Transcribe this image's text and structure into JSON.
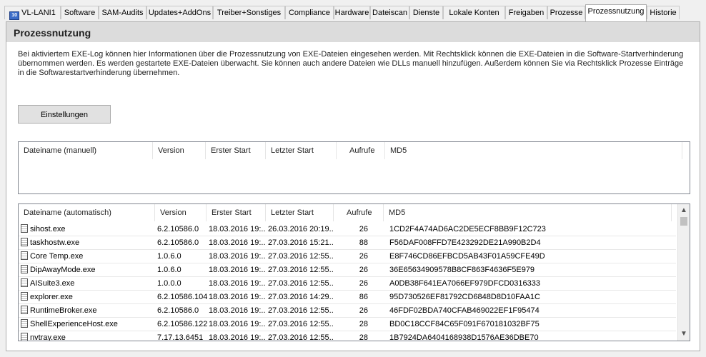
{
  "tabs": [
    {
      "label": "VL-LANI1",
      "icon": "computer-icon"
    },
    {
      "label": "Software"
    },
    {
      "label": "SAM-Audits"
    },
    {
      "label": "Updates+AddOns"
    },
    {
      "label": "Treiber+Sonstiges"
    },
    {
      "label": "Compliance"
    },
    {
      "label": "Hardware"
    },
    {
      "label": "Dateiscan"
    },
    {
      "label": "Dienste"
    },
    {
      "label": "Lokale Konten"
    },
    {
      "label": "Freigaben"
    },
    {
      "label": "Prozesse"
    },
    {
      "label": "Prozessnutzung",
      "active": true
    },
    {
      "label": "Historie"
    }
  ],
  "panel": {
    "title": "Prozessnutzung",
    "description": "Bei aktiviertem EXE-Log können hier Informationen über die Prozessnutzung von EXE-Dateien eingesehen werden. Mit Rechtsklick können die EXE-Dateien in die Software-Startverhinderung übernommen werden. Es werden gestartete EXE-Dateien überwacht. Sie können auch andere Dateien wie DLLs manuell hinzufügen. Außerdem können Sie via Rechtsklick Prozesse Einträge in die Softwarestartverhinderung übernehmen.",
    "settings_button": "Einstellungen"
  },
  "manual_list": {
    "columns": [
      "Dateiname (manuell)",
      "Version",
      "Erster Start",
      "Letzter Start",
      "Aufrufe",
      "MD5"
    ],
    "rows": []
  },
  "auto_list": {
    "columns": [
      "Dateiname (automatisch)",
      "Version",
      "Erster Start",
      "Letzter Start",
      "Aufrufe",
      "MD5"
    ],
    "rows": [
      {
        "name": "sihost.exe",
        "version": "6.2.10586.0",
        "first": "18.03.2016 19:...",
        "last": "26.03.2016 20:19...",
        "calls": "26",
        "md5": "1CD2F4A74AD6AC2DE5ECF8BB9F12C723"
      },
      {
        "name": "taskhostw.exe",
        "version": "6.2.10586.0",
        "first": "18.03.2016 19:...",
        "last": "27.03.2016 15:21...",
        "calls": "88",
        "md5": "F56DAF008FFD7E423292DE21A990B2D4"
      },
      {
        "name": "Core Temp.exe",
        "version": "1.0.6.0",
        "first": "18.03.2016 19:...",
        "last": "27.03.2016 12:55...",
        "calls": "26",
        "md5": "E8F746CD86EFBCD5AB43F01A59CFE49D"
      },
      {
        "name": "DipAwayMode.exe",
        "version": "1.0.6.0",
        "first": "18.03.2016 19:...",
        "last": "27.03.2016 12:55...",
        "calls": "26",
        "md5": "36E65634909578B8CF863F4636F5E979"
      },
      {
        "name": "AISuite3.exe",
        "version": "1.0.0.0",
        "first": "18.03.2016 19:...",
        "last": "27.03.2016 12:55...",
        "calls": "26",
        "md5": "A0DB38F641EA7066EF979DFCD0316333"
      },
      {
        "name": "explorer.exe",
        "version": "6.2.10586.104",
        "first": "18.03.2016 19:...",
        "last": "27.03.2016 14:29...",
        "calls": "86",
        "md5": "95D730526EF81792CD6848D8D10FAA1C"
      },
      {
        "name": "RuntimeBroker.exe",
        "version": "6.2.10586.0",
        "first": "18.03.2016 19:...",
        "last": "27.03.2016 12:55...",
        "calls": "26",
        "md5": "46FDF02BDA740CFAB469022EF1F95474"
      },
      {
        "name": "ShellExperienceHost.exe",
        "version": "6.2.10586.122",
        "first": "18.03.2016 19:...",
        "last": "27.03.2016 12:55...",
        "calls": "28",
        "md5": "BD0C18CCF84C65F091F670181032BF75"
      },
      {
        "name": "nvtray.exe",
        "version": "7.17.13.6451",
        "first": "18.03.2016 19:...",
        "last": "27.03.2016 12:55...",
        "calls": "28",
        "md5": "1B7924DA6404168938D1576AE36DBE70"
      }
    ]
  }
}
